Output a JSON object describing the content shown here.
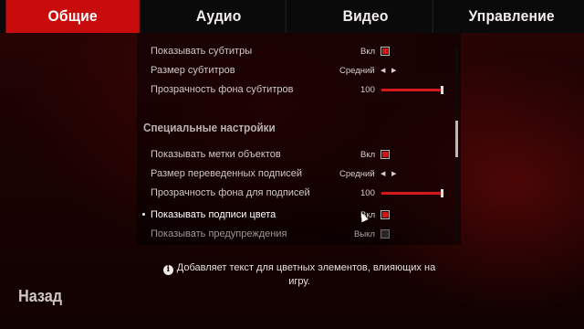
{
  "tabs": [
    {
      "label": "Общие",
      "active": true
    },
    {
      "label": "Аудио",
      "active": false
    },
    {
      "label": "Видео",
      "active": false
    },
    {
      "label": "Управление",
      "active": false
    }
  ],
  "settings": {
    "subtitles": {
      "label": "Показывать субтитры",
      "value": "Вкл",
      "checked": true
    },
    "subtitle_size": {
      "label": "Размер субтитров",
      "value": "Средний"
    },
    "subtitle_bg_opacity": {
      "label": "Прозрачность фона субтитров",
      "value": "100",
      "level_percent": 100
    },
    "section_title": "Специальные настройки",
    "object_markers": {
      "label": "Показывать метки объектов",
      "value": "Вкл",
      "checked": true
    },
    "translated_captions_size": {
      "label": "Размер переведенных подписей",
      "value": "Средний"
    },
    "captions_bg_opacity": {
      "label": "Прозрачность фона для подписей",
      "value": "100",
      "level_percent": 100
    },
    "color_captions": {
      "label": "Показывать подписи цвета",
      "value": "Вкл",
      "checked": true,
      "selected": true
    },
    "warnings": {
      "label": "Показывать предупреждения",
      "value": "Выкл",
      "checked": false
    }
  },
  "hint": {
    "icon": "info-icon",
    "text": "Добавляет текст для цветных элементов, влияющих на игру."
  },
  "back_label": "Назад",
  "colors": {
    "accent": "#c80c0c",
    "slider": "#d51818"
  }
}
